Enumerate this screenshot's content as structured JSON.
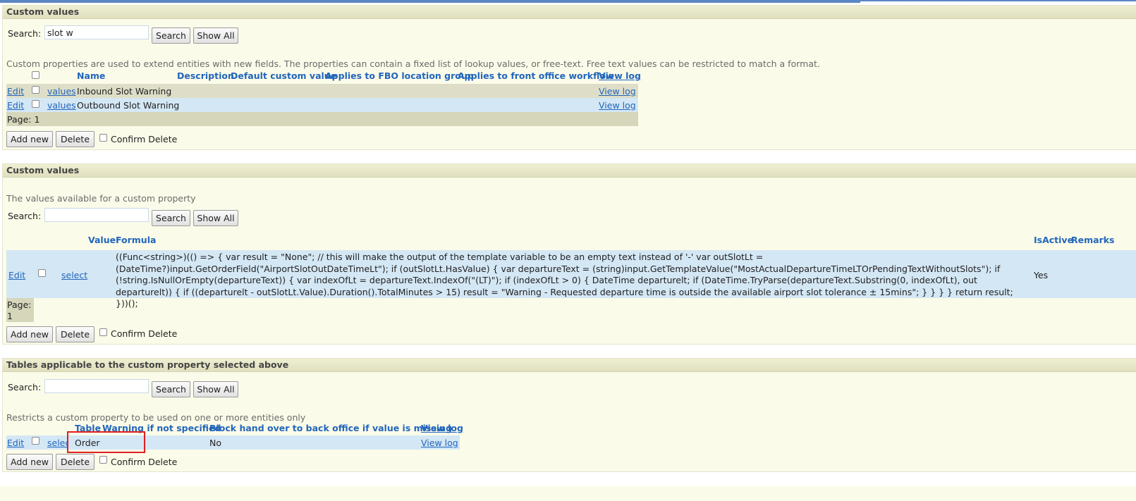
{
  "panel1": {
    "title": "Custom values",
    "search_label": "Search:",
    "search_value": "slot w",
    "search_btn": "Search",
    "showall_btn": "Show All",
    "description": "Custom properties are used to extend entities with new fields. The properties can contain a fixed list of lookup values, or free-text. Free text values can be restricted to match a format.",
    "columns": [
      "Name",
      "Description",
      "Default custom value",
      "Applies to FBO location group",
      "Applies to front office workflow",
      "View log"
    ],
    "rows": [
      {
        "edit": "Edit",
        "values": "values",
        "name": "Inbound Slot Warning",
        "log": "View log"
      },
      {
        "edit": "Edit",
        "values": "values",
        "name": "Outbound Slot Warning",
        "log": "View log"
      }
    ],
    "page": "Page: 1",
    "add_btn": "Add new",
    "delete_btn": "Delete",
    "confirm_label": "Confirm Delete"
  },
  "panel2": {
    "title": "Custom values",
    "description": "The values available for a custom property",
    "search_label": "Search:",
    "search_value": "",
    "search_btn": "Search",
    "showall_btn": "Show All",
    "columns": [
      "Value",
      "Formula",
      "IsActive",
      "Remarks"
    ],
    "row": {
      "edit": "Edit",
      "select": "select",
      "formula": "((Func<string>)(() => { var result = \"None\"; // this will make the output of the template variable to be an empty text instead of '-' var outSlotLt = (DateTime?)input.GetOrderField(\"AirportSlotOutDateTimeLt\"); if (outSlotLt.HasValue) { var departureText = (string)input.GetTemplateValue(\"MostActualDepartureTimeLTOrPendingTextWithoutSlots\"); if (!string.IsNullOrEmpty(departureText)) { var indexOfLt = departureText.IndexOf(\"(LT)\"); if (indexOfLt > 0) { DateTime departurelt; if (DateTime.TryParse(departureText.Substring(0, indexOfLt), out departurelt)) { if ((departurelt - outSlotLt.Value).Duration().TotalMinutes > 15) result = \"Warning - Requested departure time is outside the available airport slot tolerance ± 15mins\"; } } } } return result; }))();",
      "isactive": "Yes"
    },
    "page_label": "Page:",
    "page_num": "1",
    "add_btn": "Add new",
    "delete_btn": "Delete",
    "confirm_label": "Confirm Delete"
  },
  "panel3": {
    "title": "Tables applicable to the custom property selected above",
    "search_label": "Search:",
    "search_value": "",
    "search_btn": "Search",
    "showall_btn": "Show All",
    "description": "Restricts a custom property to be used on one or more entities only",
    "columns": [
      "Table",
      "Warning if not specified",
      "Block hand over to back office if value is missing",
      "View log"
    ],
    "row": {
      "edit": "Edit",
      "select": "select",
      "table": "Order",
      "block": "No",
      "log": "View log"
    },
    "add_btn": "Add new",
    "delete_btn": "Delete",
    "confirm_label": "Confirm Delete"
  },
  "colors": {
    "link": "#2266bb",
    "row_alt": "#d4e7f5",
    "panel_bg": "#fbfbe9",
    "highlight": "#e02020"
  }
}
